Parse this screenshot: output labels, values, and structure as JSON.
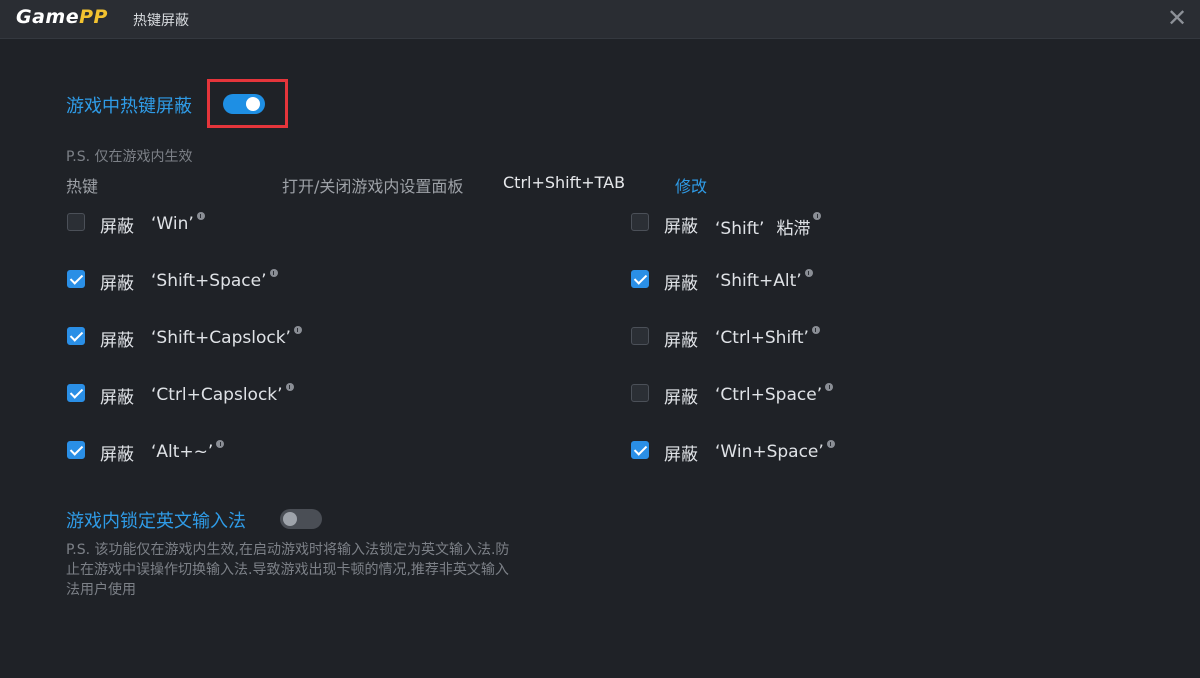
{
  "app": {
    "logo_main": "Game",
    "logo_accent": "PP",
    "title": "热键屏蔽",
    "close_glyph": "✕"
  },
  "game_hotkey_block": {
    "title": "游戏中热键屏蔽",
    "enabled": true,
    "note": "P.S. 仅在游戏内生效",
    "hotkey_label": "热键",
    "hotkey_desc": "打开/关闭游戏内设置面板",
    "hotkey_value": "Ctrl+Shift+TAB",
    "edit_label": "修改"
  },
  "options_left": [
    {
      "label": "屏蔽",
      "key": "‘Win’",
      "checked": false
    },
    {
      "label": "屏蔽",
      "key": "‘Shift+Space’",
      "checked": true
    },
    {
      "label": "屏蔽",
      "key": "‘Shift+Capslock’",
      "checked": true
    },
    {
      "label": "屏蔽",
      "key": "‘Ctrl+Capslock’",
      "checked": true
    },
    {
      "label": "屏蔽",
      "key": "‘Alt+~’",
      "checked": true
    }
  ],
  "options_right": [
    {
      "label": "屏蔽",
      "key": "‘Shift’",
      "extra": "粘滞",
      "checked": false
    },
    {
      "label": "屏蔽",
      "key": "‘Shift+Alt’",
      "checked": true
    },
    {
      "label": "屏蔽",
      "key": "‘Ctrl+Shift’",
      "checked": false
    },
    {
      "label": "屏蔽",
      "key": "‘Ctrl+Space’",
      "checked": false
    },
    {
      "label": "屏蔽",
      "key": "‘Win+Space’",
      "checked": true
    }
  ],
  "lock_english_ime": {
    "title": "游戏内锁定英文输入法",
    "enabled": false,
    "description": "P.S. 该功能仅在游戏内生效,在启动游戏时将输入法锁定为英文输入法.防止在游戏中误操作切换输入法.导致游戏出现卡顿的情况,推荐非英文输入法用户使用"
  },
  "colors": {
    "accent": "#2f9be6",
    "highlight": "#e5353b",
    "background": "#1f2227"
  }
}
